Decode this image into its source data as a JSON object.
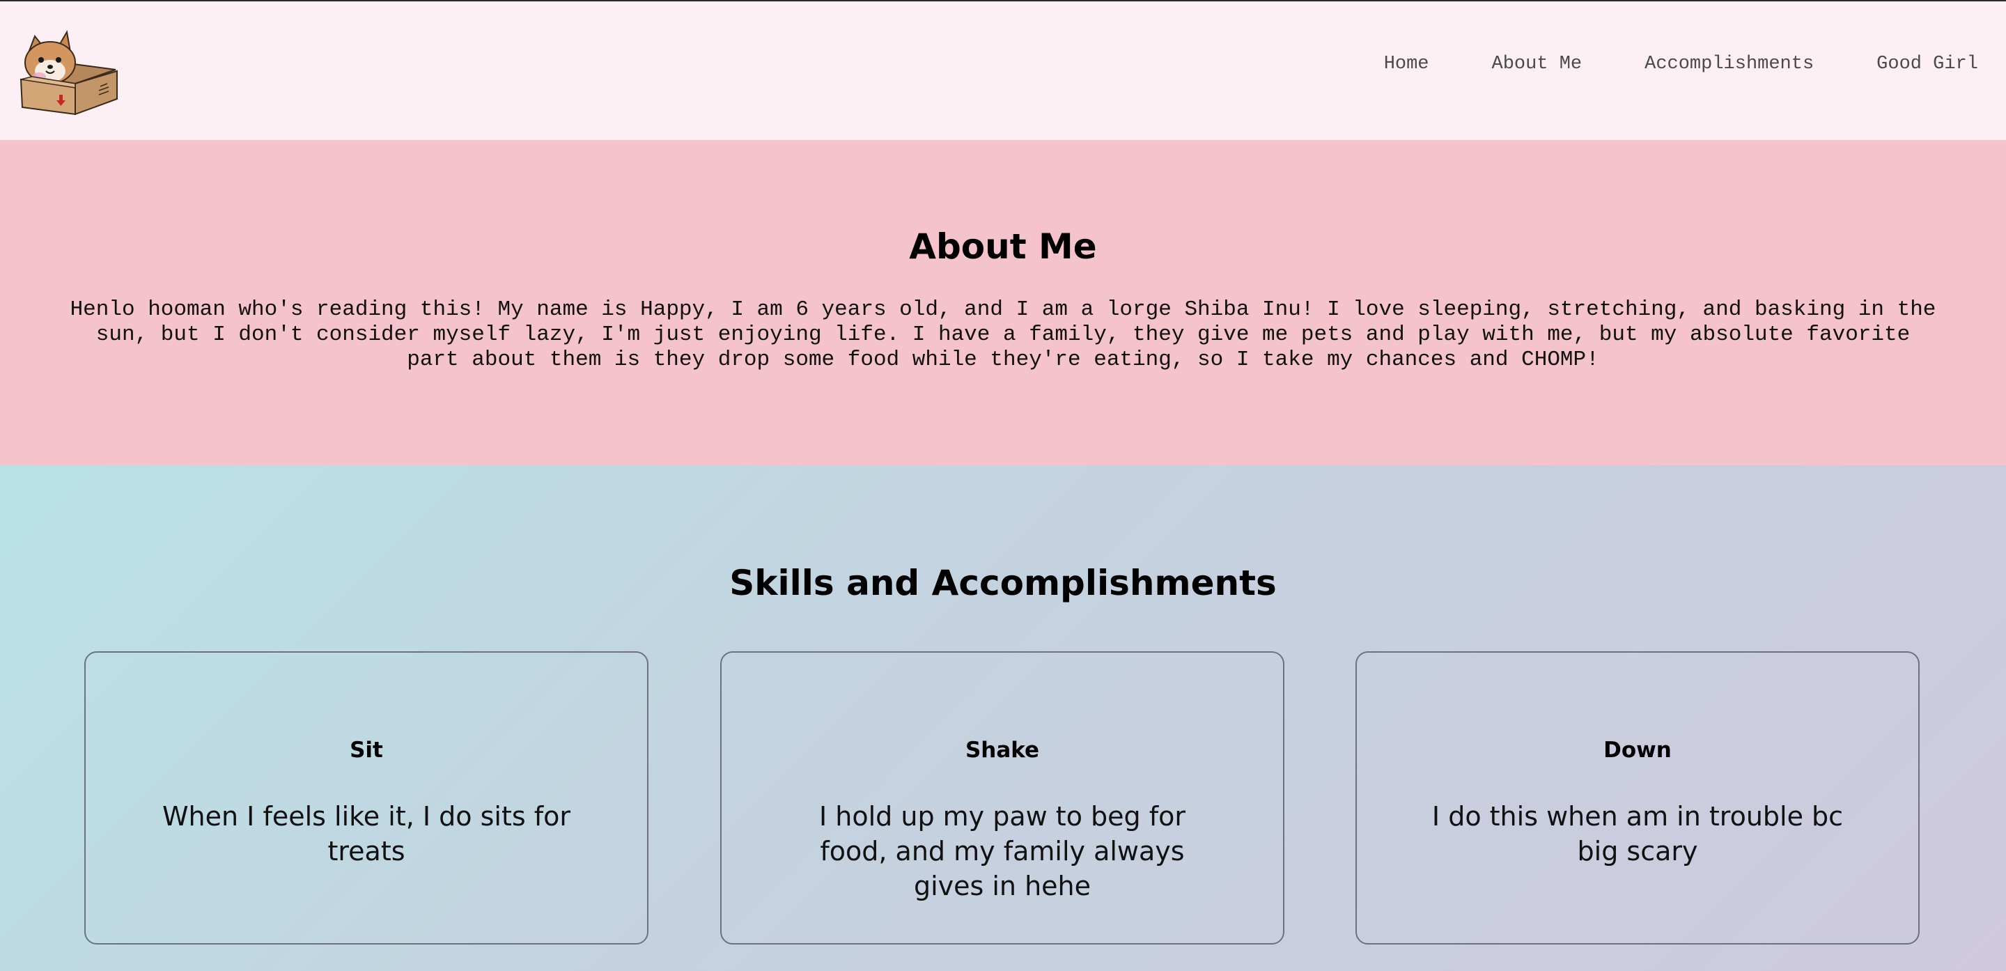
{
  "nav": {
    "items": [
      "Home",
      "About Me",
      "Accomplishments",
      "Good Girl"
    ]
  },
  "about": {
    "title": "About Me",
    "text": "Henlo hooman who's reading this! My name is Happy, I am 6 years old, and I am a lorge Shiba Inu! I love sleeping, stretching, and basking in the sun, but I don't consider myself lazy, I'm just enjoying life. I have a family, they give me pets and play with me, but my absolute favorite part about them is they drop some food while they're eating, so I take my chances and CHOMP!"
  },
  "skills": {
    "title": "Skills and Accomplishments",
    "cards": [
      {
        "title": "Sit",
        "text": "When I feels like it, I do sits for treats"
      },
      {
        "title": "Shake",
        "text": "I hold up my paw to beg for food, and my family always gives in hehe"
      },
      {
        "title": "Down",
        "text": "I do this when am in trouble bc big scary"
      }
    ]
  },
  "colors": {
    "header_bg": "#fdf0f4",
    "about_bg": "#f5c3cc",
    "skills_gradient_start": "#b9e2e6",
    "skills_gradient_end": "#cfc9de"
  },
  "icons": {
    "logo": "shiba-in-box-icon"
  }
}
